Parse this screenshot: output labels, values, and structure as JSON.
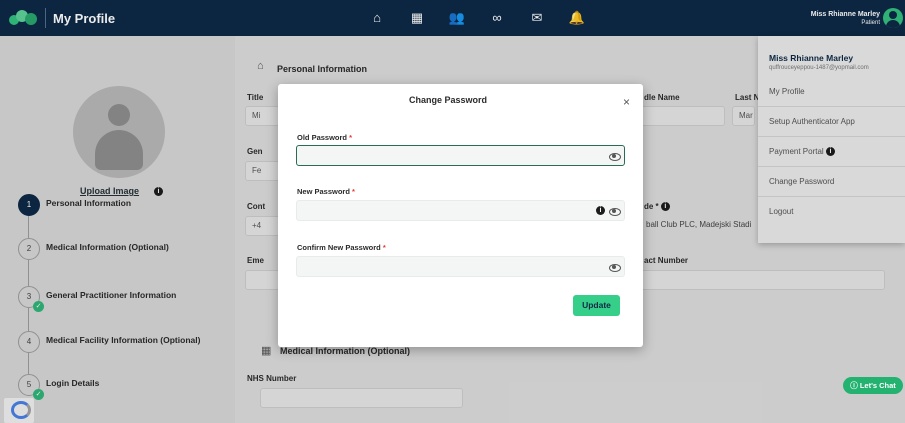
{
  "header": {
    "title": "My Profile",
    "nav_icons": [
      "home-icon",
      "calendar-icon",
      "users-icon",
      "link-icon",
      "mail-icon",
      "bell-icon"
    ],
    "user_name": "Miss Rhianne Marley",
    "user_role": "Patient"
  },
  "sidebar": {
    "upload_label": "Upload Image",
    "steps": [
      {
        "num": "1",
        "label": "Personal Information",
        "state": "active"
      },
      {
        "num": "2",
        "label": "Medical Information (Optional)",
        "state": "pending"
      },
      {
        "num": "3",
        "label": "General Practitioner Information",
        "state": "done"
      },
      {
        "num": "4",
        "label": "Medical Facility Information (Optional)",
        "state": "pending"
      },
      {
        "num": "5",
        "label": "Login Details",
        "state": "done"
      }
    ]
  },
  "main": {
    "personal_heading": "Personal Information",
    "title_label": "Title",
    "title_value": "Mi",
    "gender_label": "Gen",
    "gender_value": "Fe",
    "contact_label": "Cont",
    "contact_value": "+4",
    "emergency_label": "Eme",
    "middle_name_label": "dle Name",
    "last_name_label": "Last N",
    "last_name_value": "Mar",
    "postcode_label": "de *",
    "address_value": "ball Club PLC, Madejski Stadi",
    "contact_number_label": "act Number",
    "medical_heading": "Medical Information (Optional)",
    "nhs_label": "NHS Number"
  },
  "dropdown": {
    "name": "Miss Rhianne Marley",
    "email": "quffrouceyeppou-1487@yopmail.com",
    "items": [
      "My Profile",
      "Setup Authenticator App",
      "Payment Portal",
      "Change Password",
      "Logout"
    ]
  },
  "modal": {
    "title": "Change Password",
    "old_password_label": "Old Password",
    "new_password_label": "New Password",
    "confirm_password_label": "Confirm New Password",
    "required_mark": "*",
    "update_label": "Update",
    "close_label": "×"
  },
  "chat": {
    "label": "Let's Chat"
  },
  "colors": {
    "header_bg": "#0e2a47",
    "accent_green": "#36cf8a",
    "required_red": "#e53935"
  }
}
